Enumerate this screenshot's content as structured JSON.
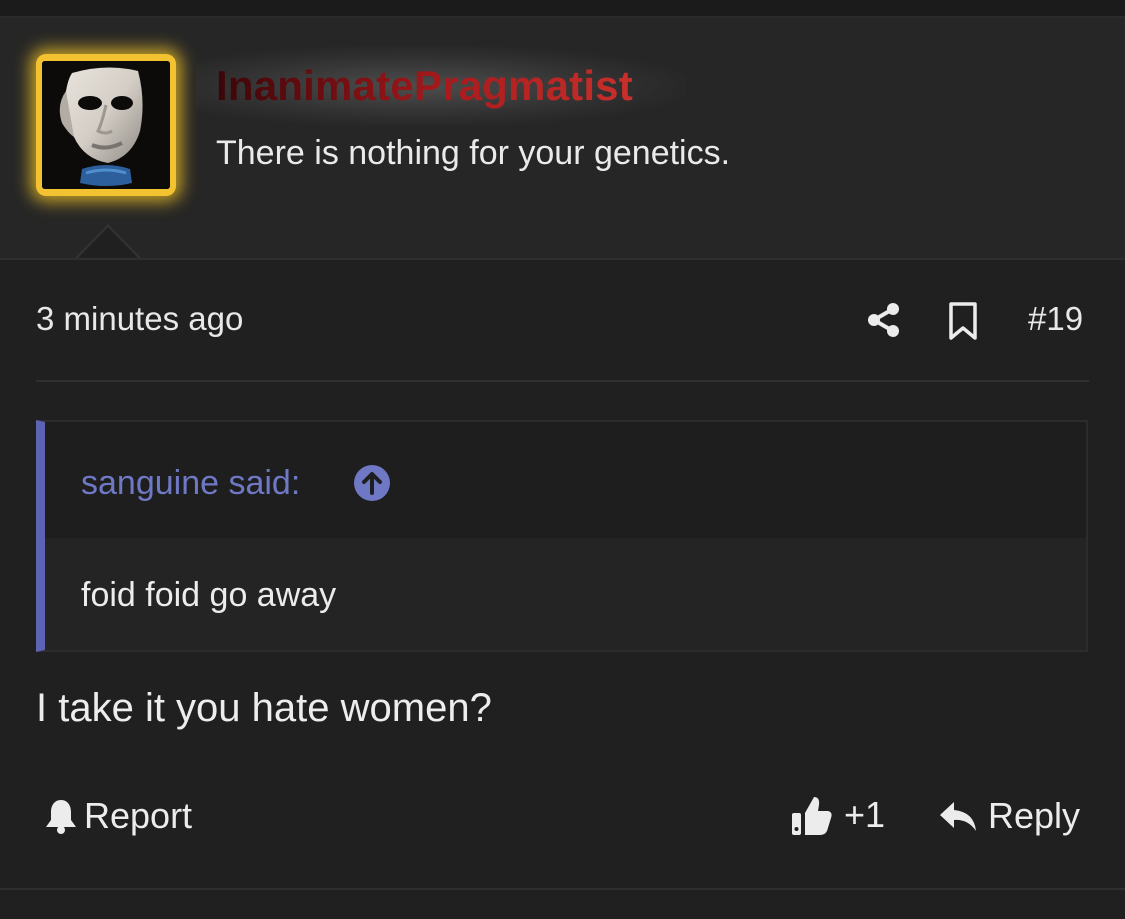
{
  "post": {
    "author": {
      "username": "InanimatePragmatist",
      "user_title": "There is nothing for your genetics.",
      "avatar_description": "mask-avatar"
    },
    "timestamp": "3 minutes ago",
    "post_number": "#19",
    "quote": {
      "author_label": "sanguine said:",
      "text": "foid foid go away"
    },
    "body": "I take it you hate women?",
    "actions": {
      "report_label": "Report",
      "like_count": "+1",
      "reply_label": "Reply"
    }
  },
  "colors": {
    "background": "#202020",
    "header_background": "#262626",
    "avatar_frame": "#f2c231",
    "username_gradient_start": "#3a0608",
    "username_gradient_end": "#c9302c",
    "quote_accent": "#5c63b5",
    "quote_author": "#6f78c5"
  },
  "icons": {
    "share": "share-icon",
    "bookmark": "bookmark-icon",
    "quote_jump": "arrow-up-circle-icon",
    "report": "bell-icon",
    "like": "thumbs-up-icon",
    "reply": "reply-arrow-icon"
  }
}
